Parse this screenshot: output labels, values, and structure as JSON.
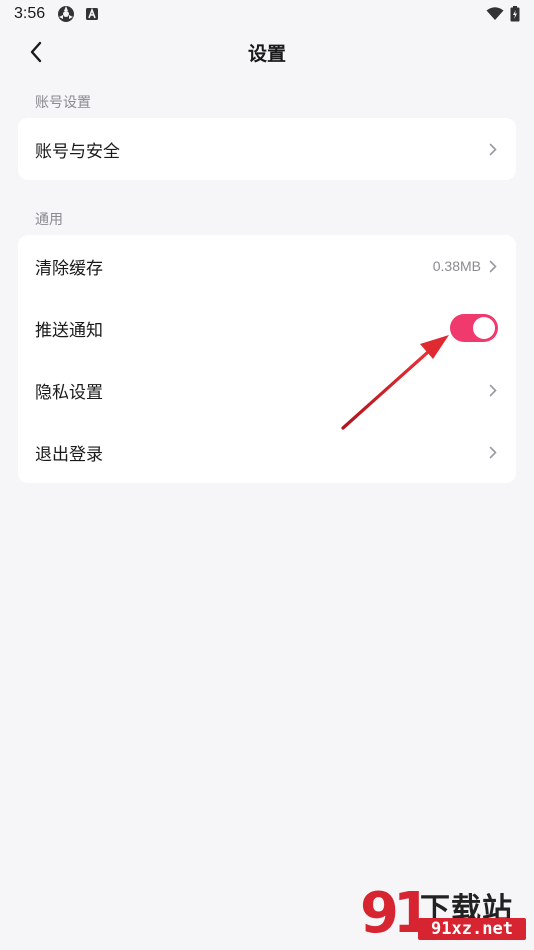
{
  "status_bar": {
    "time": "3:56"
  },
  "header": {
    "title": "设置"
  },
  "sections": [
    {
      "label": "账号设置",
      "items": [
        {
          "label": "账号与安全"
        }
      ]
    },
    {
      "label": "通用",
      "items": [
        {
          "label": "清除缓存",
          "value": "0.38MB"
        },
        {
          "label": "推送通知",
          "toggle_on": true
        },
        {
          "label": "隐私设置"
        },
        {
          "label": "退出登录"
        }
      ]
    }
  ],
  "colors": {
    "accent": "#f0396c",
    "arrow": "#d8232a",
    "background": "#f6f6f9"
  },
  "watermark": {
    "number": "91",
    "title": "下载站",
    "domain": "91xz.net"
  }
}
